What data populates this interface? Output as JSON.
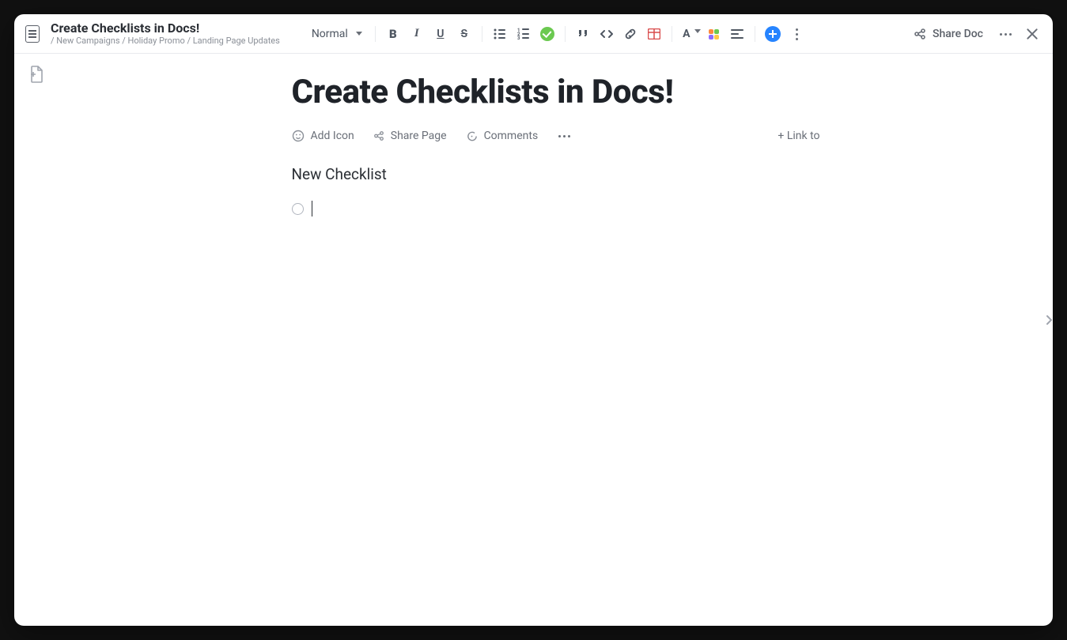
{
  "header": {
    "doc_title": "Create Checklists in Docs!",
    "breadcrumb": "/ New Campaigns / Holiday Promo / Landing Page Updates",
    "text_style": "Normal",
    "share_doc_label": "Share Doc"
  },
  "page": {
    "title": "Create Checklists in Docs!",
    "actions": {
      "add_icon": "Add Icon",
      "share_page": "Share Page",
      "comments": "Comments",
      "link_to": "+ Link to"
    },
    "section_heading": "New Checklist",
    "checklist_item_text": ""
  }
}
